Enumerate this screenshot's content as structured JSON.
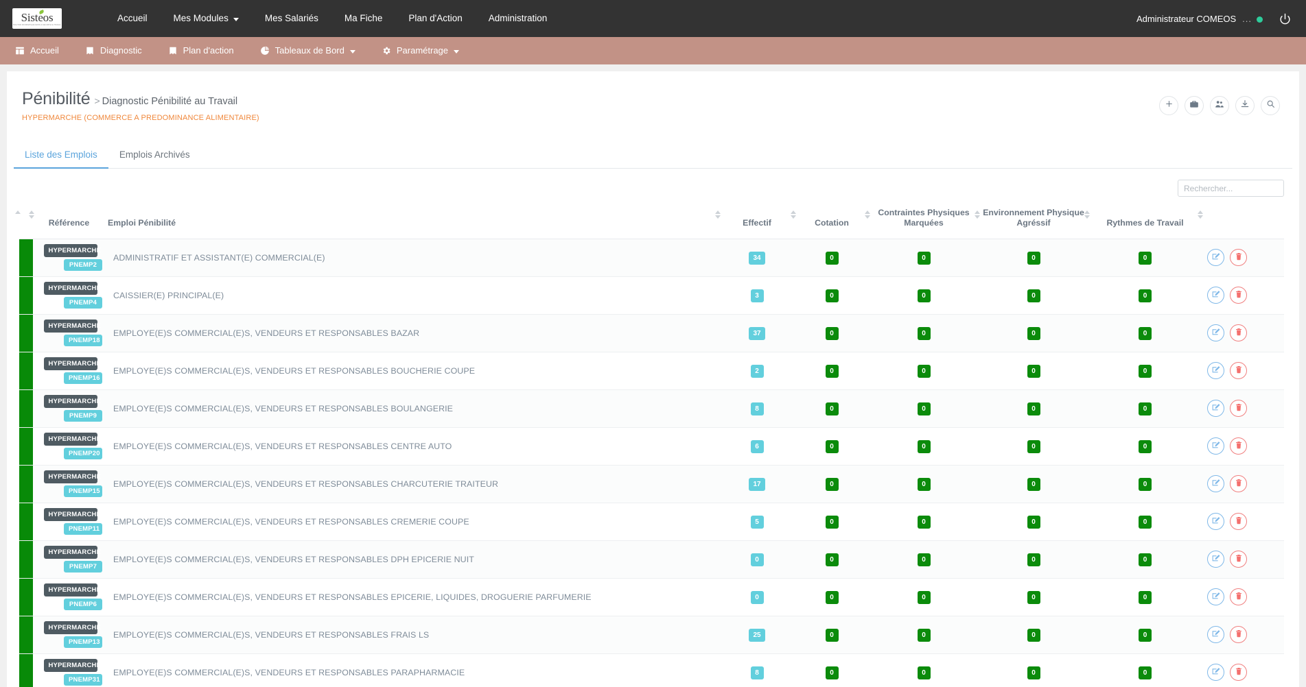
{
  "topnav": {
    "logo": {
      "word_prefix": "Sist",
      "word_accent": "e",
      "word_suffix": "os",
      "tagline": "SOLUTION INFORMATIQUE SANTE & SECURITE AU TRAVAIL"
    },
    "items": [
      {
        "label": "Accueil",
        "has_caret": false
      },
      {
        "label": "Mes Modules",
        "has_caret": true
      },
      {
        "label": "Mes Salariés",
        "has_caret": false
      },
      {
        "label": "Ma Fiche",
        "has_caret": false
      },
      {
        "label": "Plan d'Action",
        "has_caret": false
      },
      {
        "label": "Administration",
        "has_caret": false
      }
    ],
    "user": "Administrateur COMEOS",
    "user_dots": "...",
    "status_color": "#2ecc9b",
    "power_icon": "power-icon"
  },
  "subnav": {
    "bg": "#c29286",
    "items": [
      {
        "label": "Accueil",
        "icon": "home-grid-icon",
        "has_caret": false
      },
      {
        "label": "Diagnostic",
        "icon": "book-icon",
        "has_caret": false
      },
      {
        "label": "Plan d'action",
        "icon": "book-icon",
        "has_caret": false
      },
      {
        "label": "Tableaux de Bord",
        "icon": "pie-chart-icon",
        "has_caret": true
      },
      {
        "label": "Paramétrage",
        "icon": "gear-icon",
        "has_caret": true
      }
    ]
  },
  "header": {
    "title": "Pénibilité",
    "separator": ">",
    "breadcrumb": "Diagnostic Pénibilité au Travail",
    "subtitle": "HYPERMARCHE (COMMERCE A PREDOMINANCE ALIMENTAIRE)",
    "subtitle_color": "#f0883c",
    "actions": [
      {
        "name": "add-button",
        "icon": "plus-icon"
      },
      {
        "name": "briefcase-button",
        "icon": "briefcase-icon"
      },
      {
        "name": "group-button",
        "icon": "people-icon"
      },
      {
        "name": "download-button",
        "icon": "download-icon"
      },
      {
        "name": "search-button",
        "icon": "search-icon"
      }
    ]
  },
  "tabs": [
    {
      "label": "Liste des Emplois",
      "active": true
    },
    {
      "label": "Emplois Archivés",
      "active": false
    }
  ],
  "search": {
    "placeholder": "Rechercher...",
    "value": ""
  },
  "table": {
    "columns": [
      {
        "key": "bar",
        "label": "",
        "sortable": true
      },
      {
        "key": "ref",
        "label": "Référence",
        "sortable": true
      },
      {
        "key": "emploi",
        "label": "Emploi Pénibilité",
        "sortable": true
      },
      {
        "key": "eff",
        "label": "Effectif",
        "sortable": true
      },
      {
        "key": "cot",
        "label": "Cotation",
        "sortable": true
      },
      {
        "key": "cpm",
        "label": "Contraintes Physiques Marquées",
        "sortable": true
      },
      {
        "key": "epa",
        "label": "Environnement Physique Agréssif",
        "sortable": true
      },
      {
        "key": "ryt",
        "label": "Rythmes de Travail",
        "sortable": true
      },
      {
        "key": "act",
        "label": "",
        "sortable": true
      }
    ],
    "rows": [
      {
        "org": "HYPERMARCHE",
        "ref": "PNEMP2",
        "emploi": "ADMINISTRATIF ET ASSISTANT(E) COMMERCIAL(E)",
        "effectif": "34",
        "cotation": "0",
        "cpm": "0",
        "epa": "0",
        "rythmes": "0"
      },
      {
        "org": "HYPERMARCHE",
        "ref": "PNEMP4",
        "emploi": "CAISSIER(E) PRINCIPAL(E)",
        "effectif": "3",
        "cotation": "0",
        "cpm": "0",
        "epa": "0",
        "rythmes": "0"
      },
      {
        "org": "HYPERMARCHE",
        "ref": "PNEMP18",
        "emploi": "EMPLOYE(E)S COMMERCIAL(E)S, VENDEURS ET RESPONSABLES BAZAR",
        "effectif": "37",
        "cotation": "0",
        "cpm": "0",
        "epa": "0",
        "rythmes": "0"
      },
      {
        "org": "HYPERMARCHE",
        "ref": "PNEMP16",
        "emploi": "EMPLOYE(E)S COMMERCIAL(E)S, VENDEURS ET RESPONSABLES BOUCHERIE COUPE",
        "effectif": "2",
        "cotation": "0",
        "cpm": "0",
        "epa": "0",
        "rythmes": "0"
      },
      {
        "org": "HYPERMARCHE",
        "ref": "PNEMP9",
        "emploi": "EMPLOYE(E)S COMMERCIAL(E)S, VENDEURS ET RESPONSABLES BOULANGERIE",
        "effectif": "8",
        "cotation": "0",
        "cpm": "0",
        "epa": "0",
        "rythmes": "0"
      },
      {
        "org": "HYPERMARCHE",
        "ref": "PNEMP20",
        "emploi": "EMPLOYE(E)S COMMERCIAL(E)S, VENDEURS ET RESPONSABLES CENTRE AUTO",
        "effectif": "6",
        "cotation": "0",
        "cpm": "0",
        "epa": "0",
        "rythmes": "0"
      },
      {
        "org": "HYPERMARCHE",
        "ref": "PNEMP15",
        "emploi": "EMPLOYE(E)S COMMERCIAL(E)S, VENDEURS ET RESPONSABLES CHARCUTERIE TRAITEUR",
        "effectif": "17",
        "cotation": "0",
        "cpm": "0",
        "epa": "0",
        "rythmes": "0"
      },
      {
        "org": "HYPERMARCHE",
        "ref": "PNEMP11",
        "emploi": "EMPLOYE(E)S COMMERCIAL(E)S, VENDEURS ET RESPONSABLES CREMERIE COUPE",
        "effectif": "5",
        "cotation": "0",
        "cpm": "0",
        "epa": "0",
        "rythmes": "0"
      },
      {
        "org": "HYPERMARCHE",
        "ref": "PNEMP7",
        "emploi": "EMPLOYE(E)S COMMERCIAL(E)S, VENDEURS ET RESPONSABLES DPH EPICERIE NUIT",
        "effectif": "0",
        "cotation": "0",
        "cpm": "0",
        "epa": "0",
        "rythmes": "0"
      },
      {
        "org": "HYPERMARCHE",
        "ref": "PNEMP6",
        "emploi": "EMPLOYE(E)S COMMERCIAL(E)S, VENDEURS ET RESPONSABLES EPICERIE, LIQUIDES, DROGUERIE PARFUMERIE",
        "effectif": "0",
        "cotation": "0",
        "cpm": "0",
        "epa": "0",
        "rythmes": "0"
      },
      {
        "org": "HYPERMARCHE",
        "ref": "PNEMP13",
        "emploi": "EMPLOYE(E)S COMMERCIAL(E)S, VENDEURS ET RESPONSABLES FRAIS LS",
        "effectif": "25",
        "cotation": "0",
        "cpm": "0",
        "epa": "0",
        "rythmes": "0"
      },
      {
        "org": "HYPERMARCHE",
        "ref": "PNEMP31",
        "emploi": "EMPLOYE(E)S COMMERCIAL(E)S, VENDEURS ET RESPONSABLES PARAPHARMACIE",
        "effectif": "8",
        "cotation": "0",
        "cpm": "0",
        "epa": "0",
        "rythmes": "0"
      }
    ],
    "row_actions": [
      {
        "name": "edit-row-button",
        "icon": "pencil-square-icon"
      },
      {
        "name": "delete-row-button",
        "icon": "trash-icon"
      }
    ]
  },
  "colors": {
    "topnav_bg": "#333333",
    "subnav_bg": "#c29286",
    "accent_tab": "#5ba4dc",
    "badge_cyan": "#62cfdd",
    "badge_green": "#0b8b0b",
    "badge_dark": "#4f5b62",
    "status_bar_green": "#088a08",
    "subtitle_orange": "#f0883c"
  }
}
